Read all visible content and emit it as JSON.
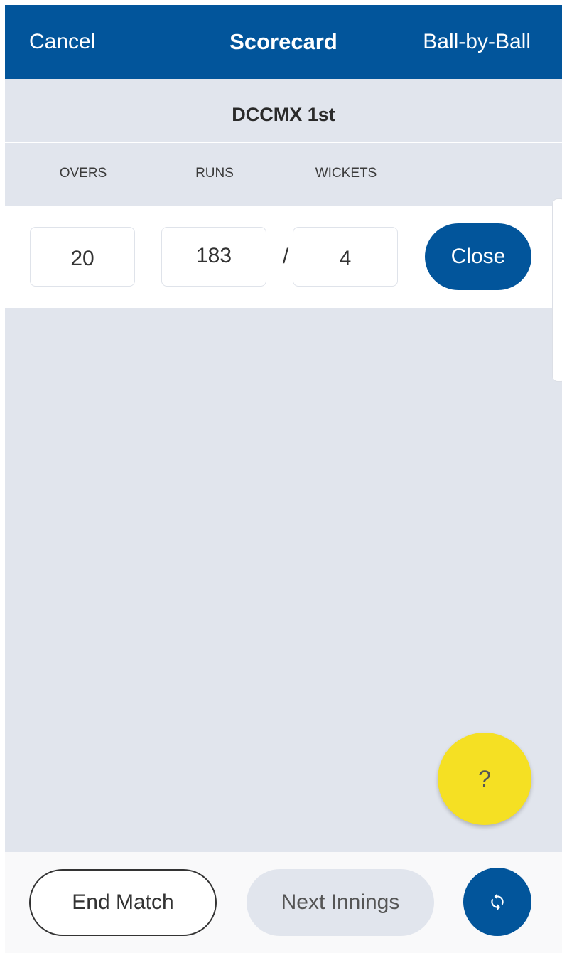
{
  "header": {
    "cancel_label": "Cancel",
    "title": "Scorecard",
    "ball_by_ball_label": "Ball-by-Ball"
  },
  "innings": {
    "title": "DCCMX 1st"
  },
  "columns": {
    "overs": "OVERS",
    "runs": "RUNS",
    "wickets": "WICKETS"
  },
  "score": {
    "overs": "20",
    "runs": "183",
    "separator": "/",
    "wickets": "4",
    "close_label": "Close"
  },
  "help": {
    "label": "?"
  },
  "footer": {
    "end_match_label": "End Match",
    "next_innings_label": "Next Innings",
    "sync_icon": "sync-icon"
  },
  "colors": {
    "primary": "#02559b",
    "background": "#e1e5ed",
    "help_fab": "#f5e023"
  }
}
